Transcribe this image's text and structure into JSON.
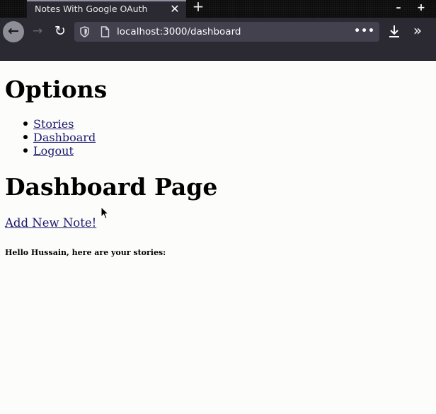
{
  "browser": {
    "tab_title": "Notes With Google OAuth",
    "tab_close": "✕",
    "new_tab": "+",
    "minimize": "–",
    "maximize": "+",
    "back": "←",
    "forward": "→",
    "reload": "↻",
    "url": "localhost:3000/dashboard",
    "page_actions": "•••",
    "overflow": "»"
  },
  "icons": {
    "shield": "shield-icon",
    "page": "page-icon",
    "download": "download-icon",
    "cursor": "mouse-cursor-icon"
  },
  "page": {
    "options_heading": "Options",
    "nav_links": [
      {
        "label": "Stories"
      },
      {
        "label": "Dashboard"
      },
      {
        "label": "Logout"
      }
    ],
    "dashboard_heading": "Dashboard Page",
    "add_note_label": "Add New Note!",
    "greeting": "Hello Hussain, here are your stories:"
  },
  "colors": {
    "tab_bar": "#0c0c0d",
    "toolbar": "#2b2a33",
    "urlbar": "#42414d",
    "page_background": "#fcfcfa",
    "link": "#1c1a70"
  }
}
